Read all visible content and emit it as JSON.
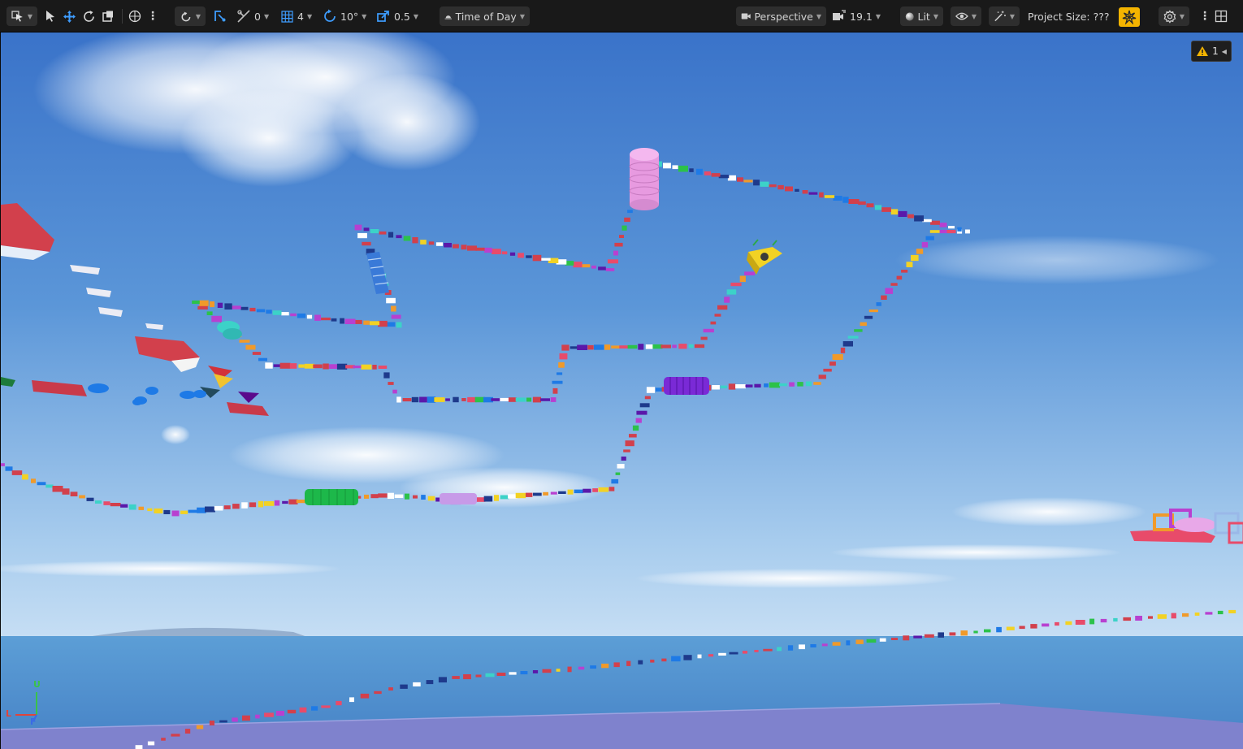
{
  "toolbar": {
    "grid_snap_value": "0",
    "grid_size_value": "4",
    "rotation_snap_value": "10°",
    "scale_snap_value": "0.5",
    "time_of_day_label": "Time of Day",
    "view_mode_label": "Perspective",
    "camera_speed_value": "19.1",
    "lighting_mode_label": "Lit",
    "project_size_label": "Project Size: ???"
  },
  "viewport": {
    "warning_count": "1",
    "axis": {
      "up": "U",
      "left": "L",
      "forward": "F"
    }
  },
  "colors": {
    "toolbar_bg": "#191919",
    "accent_blue": "#3e9dff",
    "accent_yellow": "#f4b400",
    "sky_top": "#3d7ad0",
    "water": "#4e93cf",
    "ground": "#7f82cd"
  },
  "icons": [
    "select-mode-icon",
    "arrow-select-icon",
    "move-icon",
    "rotate-icon",
    "scale-icon",
    "world-local-icon",
    "kebab-icon",
    "surface-snap-icon",
    "pivot-icon",
    "grid-snap-icon",
    "grid-size-icon",
    "rotation-snap-icon",
    "scale-snap-icon",
    "time-of-day-icon",
    "camera-icon",
    "camera-speed-icon",
    "lit-sphere-icon",
    "eye-icon",
    "fx-icon",
    "snap-star-icon",
    "gear-icon",
    "layout-icon",
    "warning-icon"
  ]
}
